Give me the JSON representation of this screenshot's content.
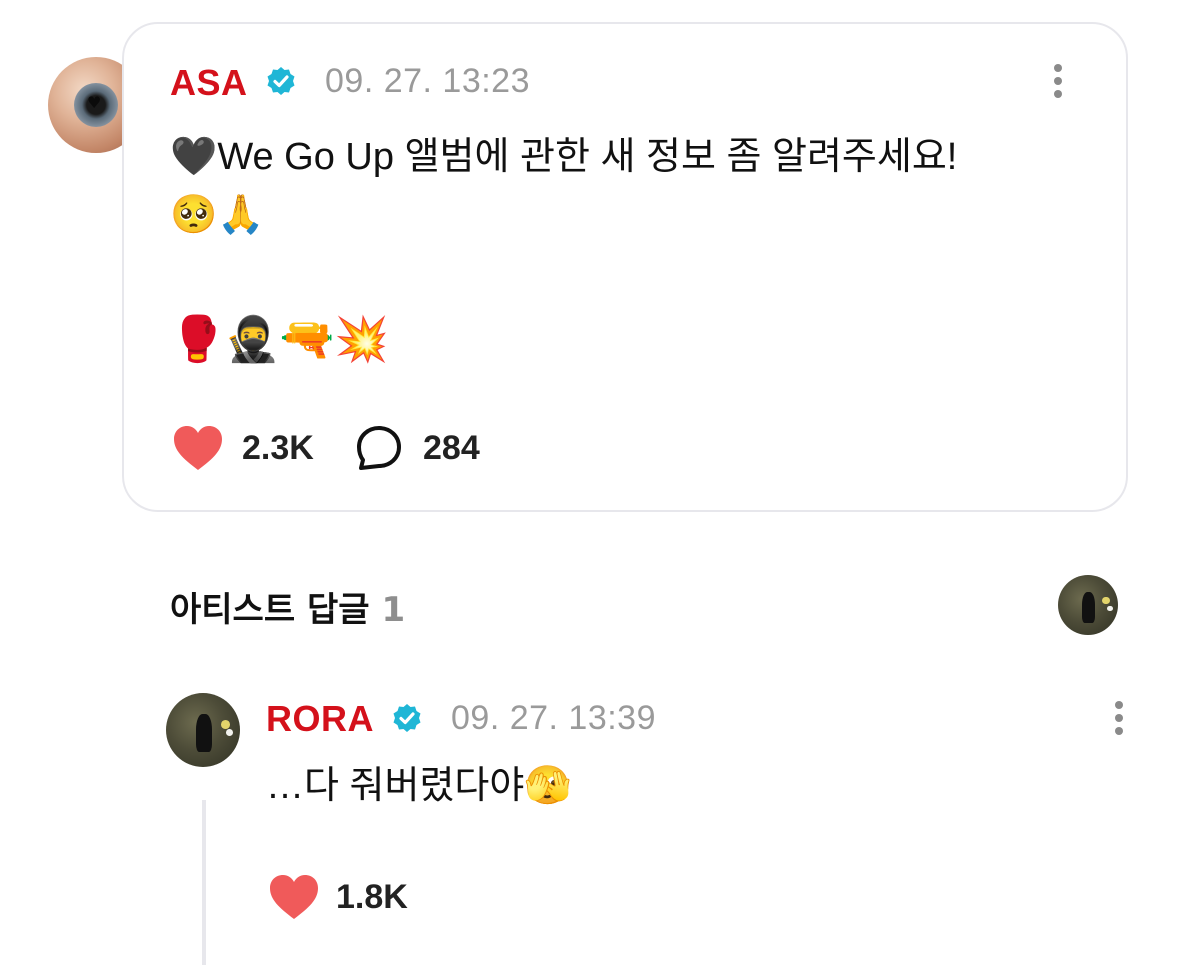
{
  "post": {
    "author": "ASA",
    "timestamp": "09. 27. 13:23",
    "text": "🖤We Go Up 앨범에 관한 새 정보 좀 알려주세요!\n🥺🙏",
    "emoji_line": "🥊🥷🔫💥",
    "likes": "2.3K",
    "comments": "284",
    "avatar_icon": "eyeball-avatar",
    "verified_icon": "verified-badge-icon",
    "more_icon": "more-vertical-icon"
  },
  "artist_replies": {
    "title": "아티스트 답글",
    "count": "1"
  },
  "reply": {
    "author": "RORA",
    "timestamp": "09. 27. 13:39",
    "text": "…다 줘버렸다야🫣",
    "likes": "1.8K"
  },
  "colors": {
    "username": "#d4111b",
    "verified": "#1fb6d6",
    "heart": "#f05a5a",
    "muted": "#9a9a9a",
    "border": "#e7e7ec"
  }
}
